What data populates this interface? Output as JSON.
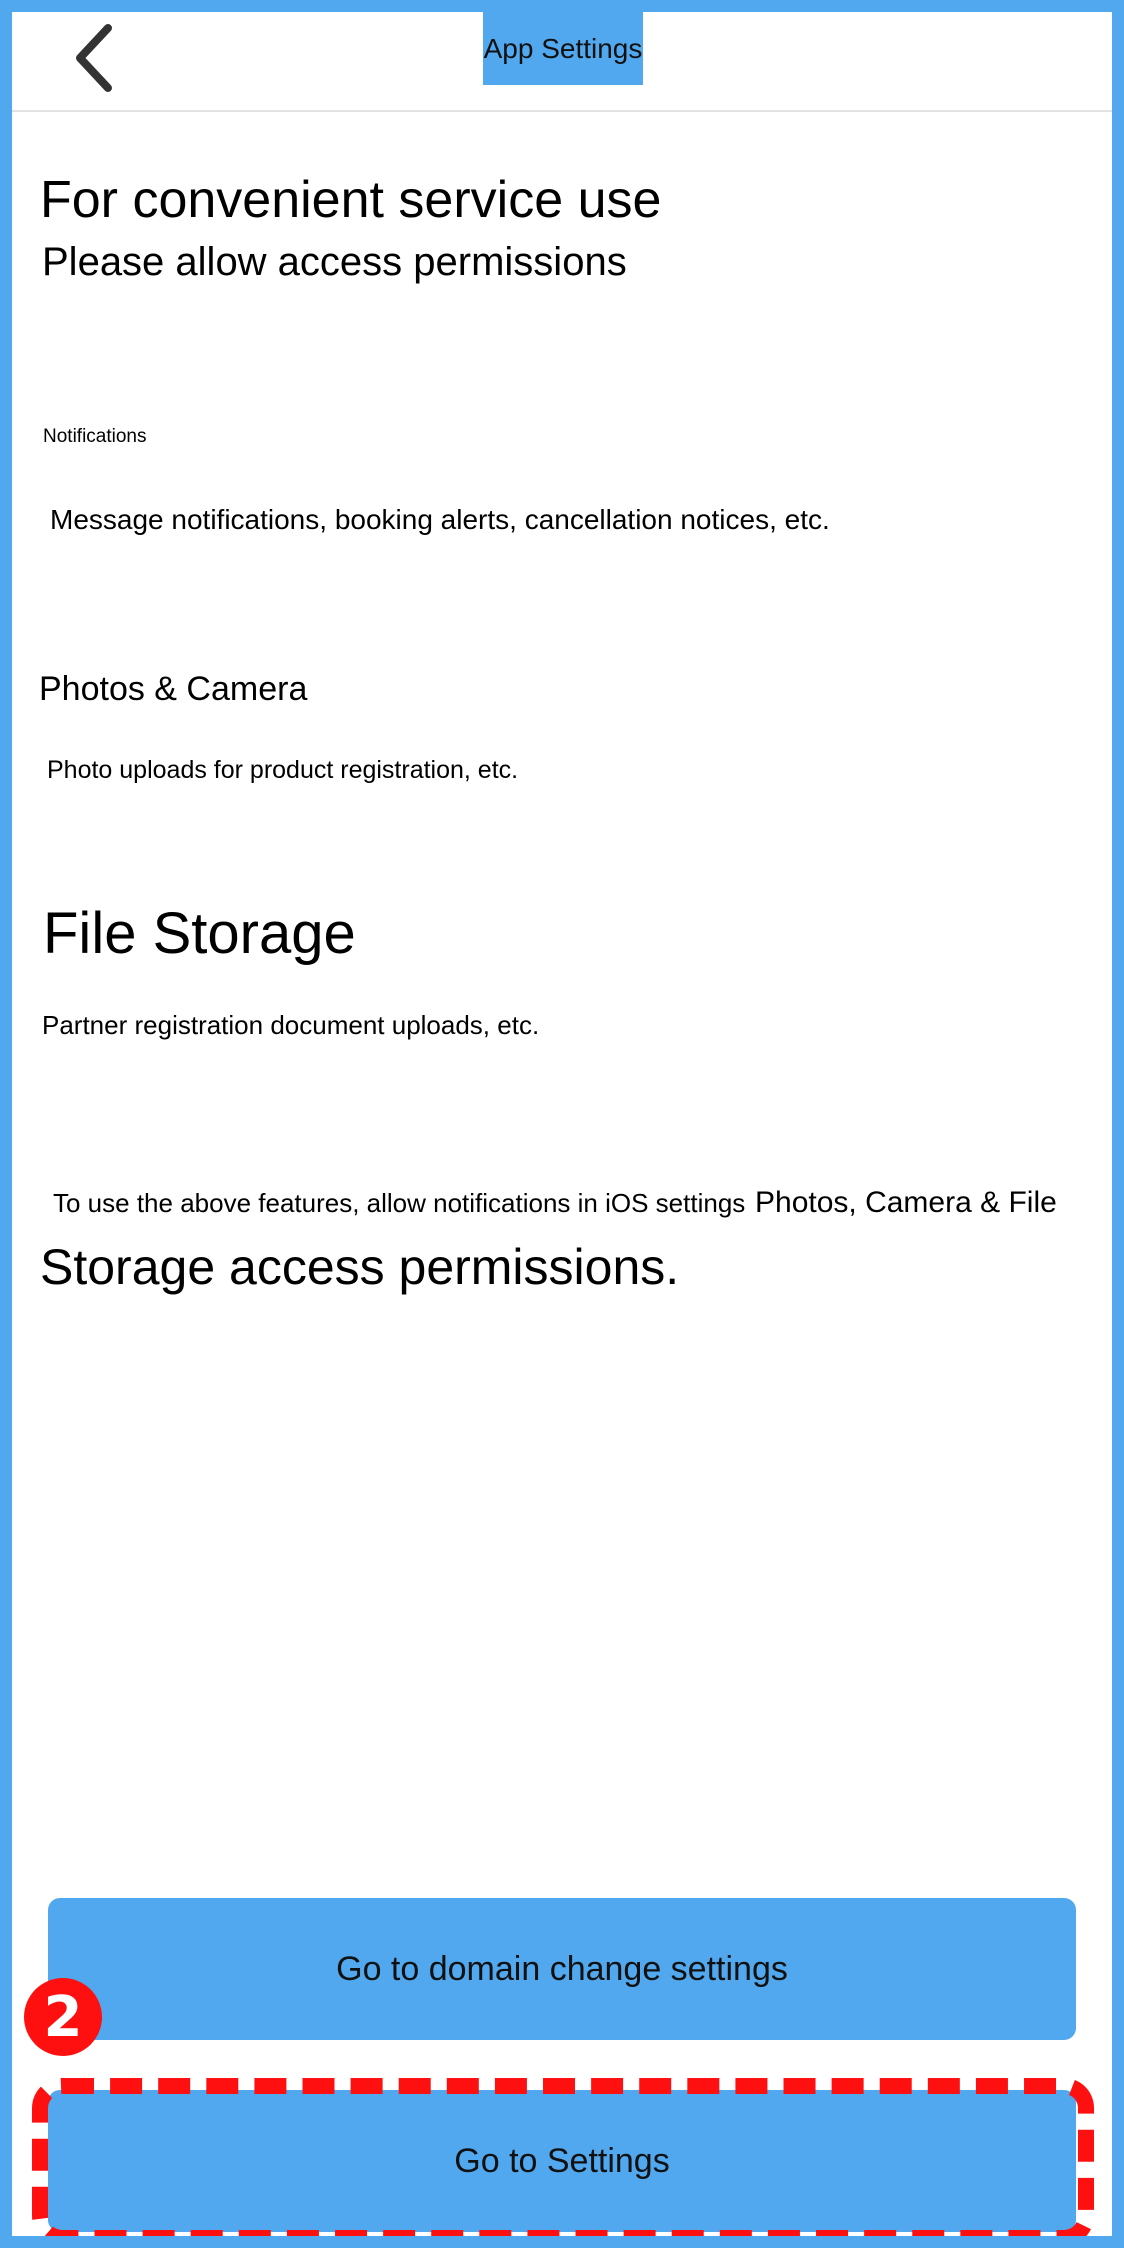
{
  "header": {
    "back_icon": "chevron-left-icon",
    "title": "App Settings"
  },
  "intro": {
    "line1": "For convenient service use",
    "line2": "Please allow access permissions"
  },
  "permissions": [
    {
      "title": "Notifications",
      "description": "Message notifications, booking alerts, cancellation notices, etc."
    },
    {
      "title": "Photos & Camera",
      "description": "Photo uploads for product registration, etc."
    },
    {
      "title": "File Storage",
      "description": "Partner registration document uploads, etc."
    }
  ],
  "notice": {
    "part1": "To use the above features, allow notifications in iOS settings",
    "part2": "Photos, Camera & File",
    "part3": "Storage access permissions."
  },
  "buttons": {
    "domain_change": "Go to domain change settings",
    "settings": "Go to Settings"
  },
  "annotation": {
    "step_number": "2",
    "highlight_color": "#ff1010"
  },
  "colors": {
    "accent": "#51a8ef",
    "text": "#000000"
  }
}
